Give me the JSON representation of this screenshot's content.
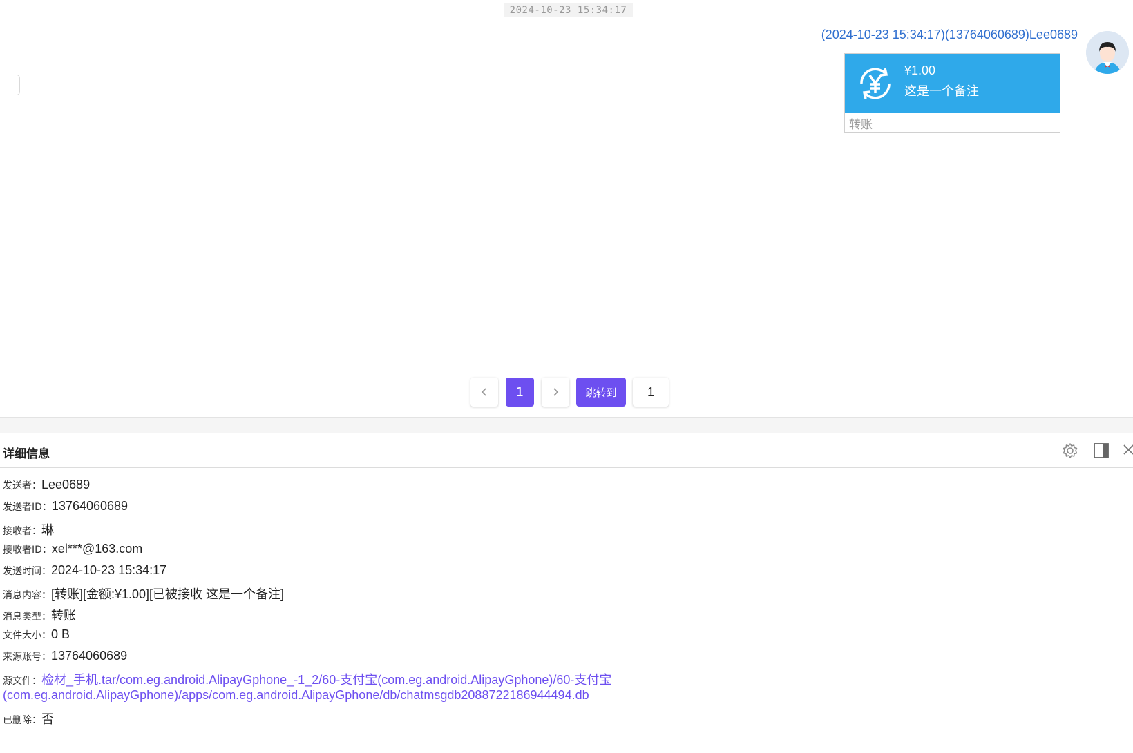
{
  "chat": {
    "timestamp": "2024-10-23 15:34:17",
    "sender_line": "(2024-10-23 15:34:17)(13764060689)Lee0689",
    "bubble": {
      "amount": "¥1.00",
      "remark": "这是一个备注",
      "type_label": "转账"
    },
    "accent_color": "#2fa9ea"
  },
  "pager": {
    "prev_icon": "chevron-left-icon",
    "current_page": "1",
    "next_icon": "chevron-right-icon",
    "jump_label": "跳转到",
    "jump_value": "1",
    "accent_color": "#6d4ff0"
  },
  "detail": {
    "title": "详细信息",
    "icons": [
      "gear-icon",
      "panel-toggle-icon",
      "close-icon"
    ],
    "rows": [
      {
        "key": "发送者：",
        "value": "Lee0689"
      },
      {
        "key": "发送者ID：",
        "value": "13764060689"
      },
      {
        "key": "接收者：",
        "value": "琳"
      },
      {
        "key": "接收者ID：",
        "value": "xel***@163.com"
      },
      {
        "key": "发送时间：",
        "value": "2024-10-23 15:34:17"
      },
      {
        "key": "消息内容：",
        "value": "[转账][金额:¥1.00][已被接收 这是一个备注]"
      },
      {
        "key": "消息类型：",
        "value": "转账"
      },
      {
        "key": "文件大小：",
        "value": "0 B"
      },
      {
        "key": "来源账号：",
        "value": "13764060689"
      }
    ],
    "source_file": {
      "key": "源文件：",
      "line1": "检材_手机.tar/com.eg.android.AlipayGphone_-1_2/60-支付宝(com.eg.android.AlipayGphone)/60-支付宝",
      "line2": "(com.eg.android.AlipayGphone)/apps/com.eg.android.AlipayGphone/db/chatmsgdb2088722186944494.db"
    },
    "deleted": {
      "key": "已删除：",
      "value": "否"
    }
  }
}
